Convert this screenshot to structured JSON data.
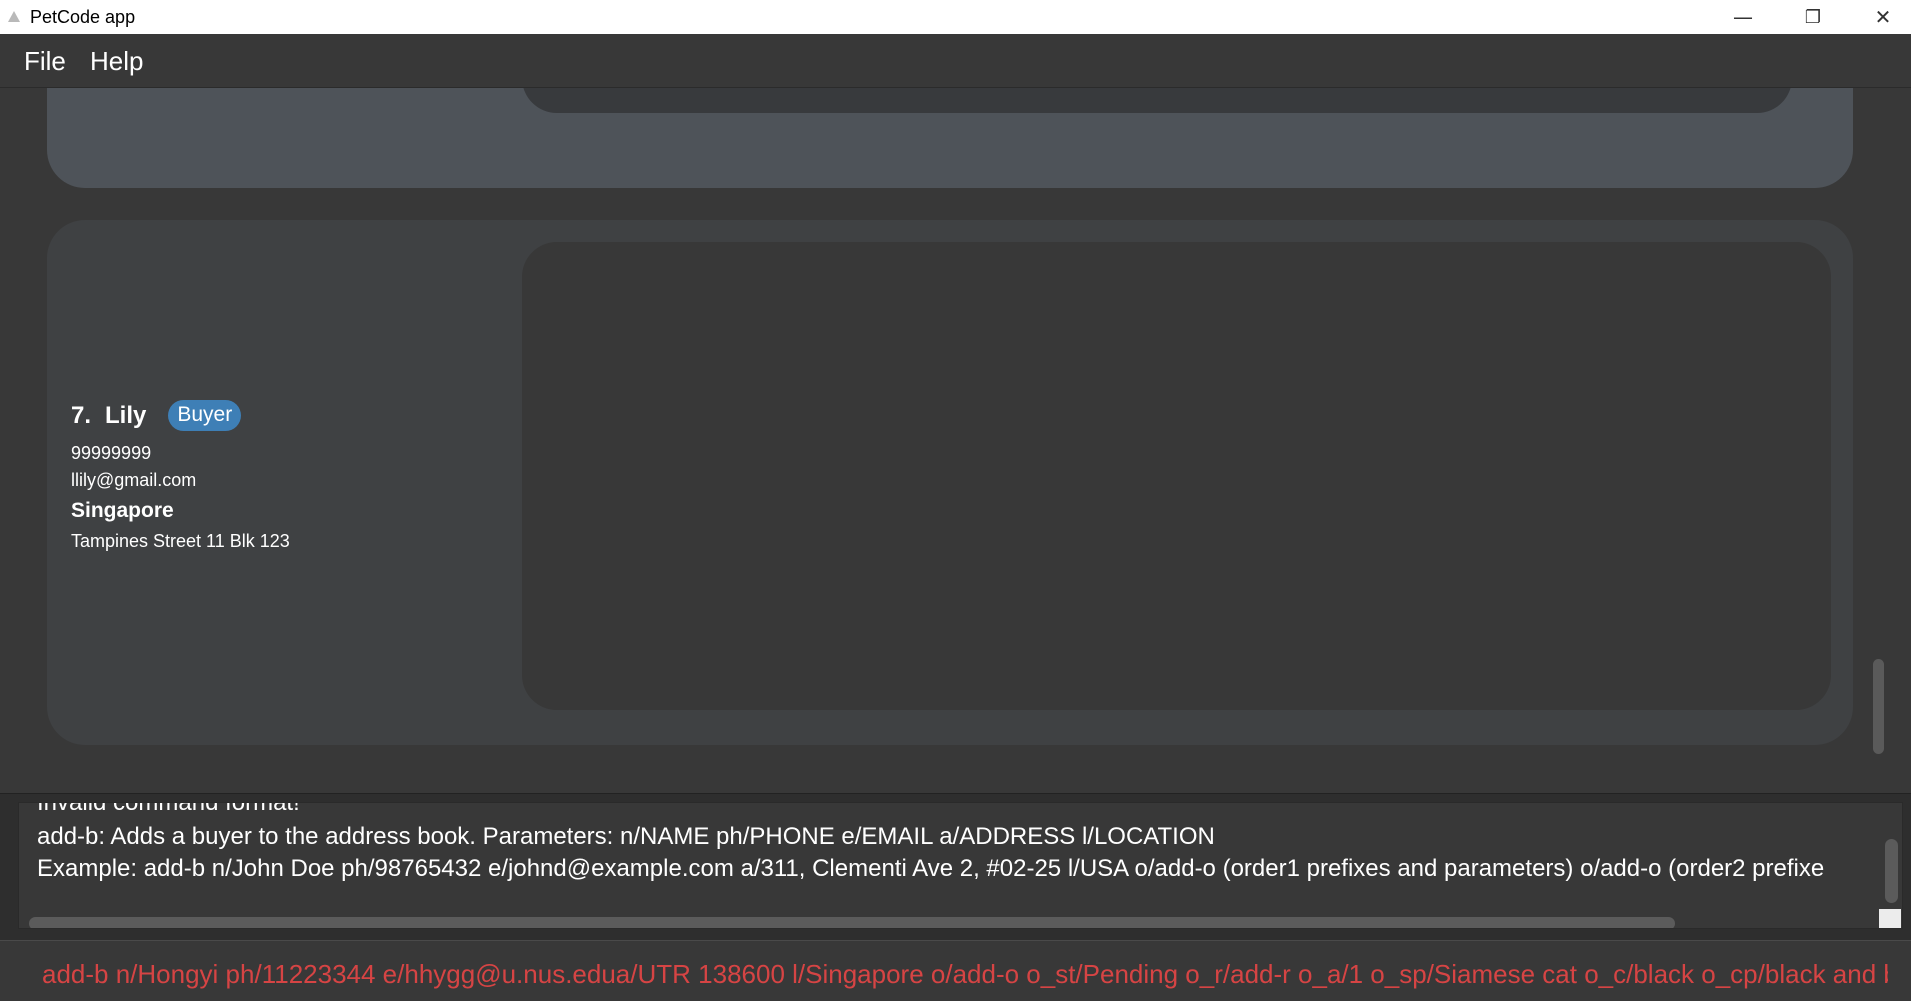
{
  "window": {
    "title": "PetCode app",
    "controls": {
      "minimize": "—",
      "restore": "❐",
      "close": "✕"
    }
  },
  "menu": {
    "file": "File",
    "help": "Help"
  },
  "person_card": {
    "index": "7.",
    "name": "Lily",
    "tag": "Buyer",
    "phone": "99999999",
    "email": "llily@gmail.com",
    "location": "Singapore",
    "address": "Tampines Street 11 Blk 123"
  },
  "result": {
    "lines": [
      "Invalid command format!",
      "add-b: Adds a buyer to the address book. Parameters: n/NAME ph/PHONE e/EMAIL a/ADDRESS l/LOCATION",
      "Example: add-b n/John Doe ph/98765432 e/johnd@example.com a/311, Clementi Ave 2, #02-25 l/USA o/add-o (order1 prefixes and parameters) o/add-o (order2 prefixe"
    ]
  },
  "command": {
    "value": "add-b n/Hongyi ph/11223344 e/hhygg@u.nus.edua/UTR 138600 l/Singapore o/add-o o_st/Pending o_r/add-r o_a/1 o_sp/Siamese cat o_c/black o_cp/black and brown o_p"
  },
  "colors": {
    "background": "#383838",
    "tag": "#3e7fb6",
    "command_text": "#d64444"
  },
  "icons": [
    "app-icon",
    "minimize-icon",
    "restore-icon",
    "close-icon"
  ]
}
